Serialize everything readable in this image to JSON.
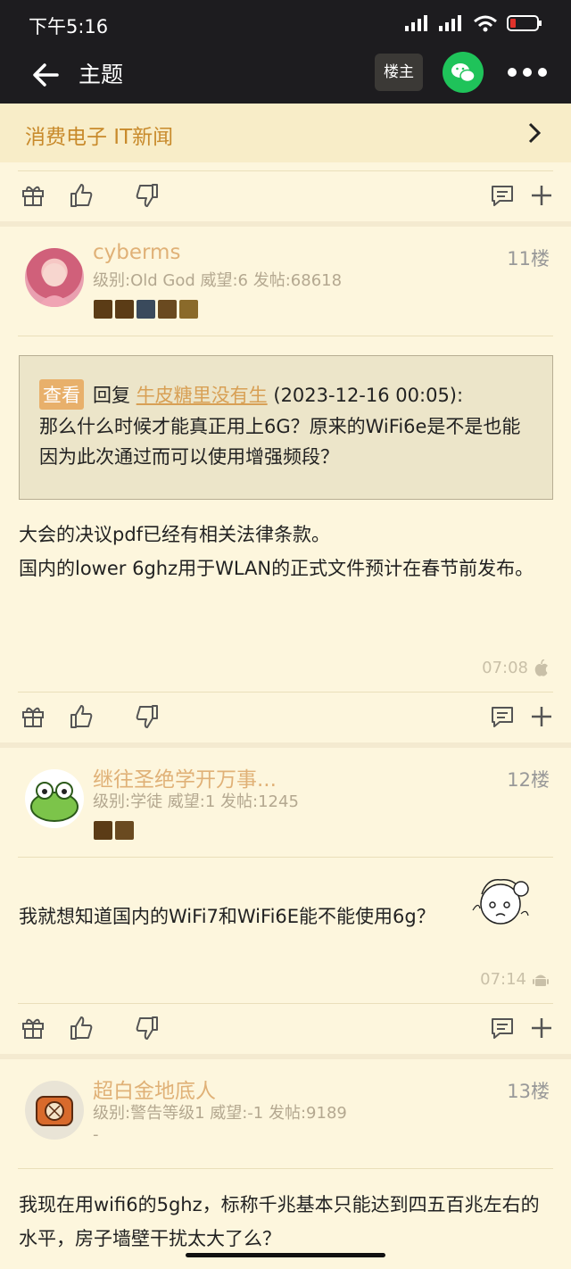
{
  "status": {
    "time": "下午5:16"
  },
  "titlebar": {
    "title": "主题",
    "op_label": "楼主"
  },
  "breadcrumb": {
    "label": "消费电子 IT新闻"
  },
  "posts": [
    {
      "name": "cyberms",
      "info": "级别:Old God 威望:6 发帖:68618",
      "floor": "11楼",
      "quote": {
        "tag": "查看",
        "prefix": "回复",
        "author": "牛皮糖里没有生",
        "date": "(2023-12-16 00:05):",
        "body": "那么什么时候才能真正用上6G？原来的WiFi6e是不是也能因为此次通过而可以使用增强频段？"
      },
      "content": "大会的决议pdf已经有相关法律条款。\n国内的lower 6ghz用于WLAN的正式文件预计在春节前发布。",
      "time": "07:08",
      "device": "apple-icon"
    },
    {
      "name": "继往圣绝学开万事...",
      "info": "级别:学徒 威望:1 发帖:1245",
      "floor": "12楼",
      "content": "我就想知道国内的WiFi7和WiFi6E能不能使用6g？",
      "time": "07:14",
      "device": "android-icon"
    },
    {
      "name": "超白金地底人",
      "info": "级别:警告等级1 威望:-1 发帖:9189",
      "extra": "-",
      "floor": "13楼",
      "content": "我现在用wifi6的5ghz，标称千兆基本只能达到四五百兆左右的水平，房子墙壁干扰太大了么？"
    }
  ]
}
